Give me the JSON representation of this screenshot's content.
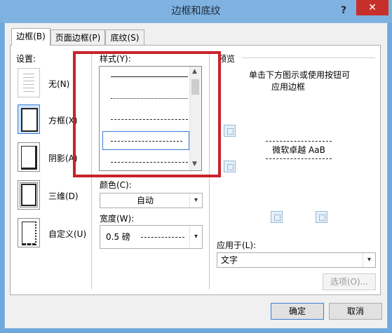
{
  "window": {
    "title": "边框和底纹",
    "help": "?",
    "close": "✕"
  },
  "tabs": [
    {
      "label": "边框(B)"
    },
    {
      "label": "页面边框(P)"
    },
    {
      "label": "底纹(S)"
    }
  ],
  "settings": {
    "label": "设置:",
    "presets": [
      {
        "label": "无(N)"
      },
      {
        "label": "方框(X)"
      },
      {
        "label": "阴影(A)"
      },
      {
        "label": "三维(D)"
      },
      {
        "label": "自定义(U)"
      }
    ]
  },
  "style": {
    "label": "样式(Y):"
  },
  "color": {
    "label": "颜色(C):",
    "value": "自动"
  },
  "width": {
    "label": "宽度(W):",
    "value": "0.5 磅"
  },
  "preview": {
    "label": "预览",
    "hint_line1": "单击下方图示或使用按钮可",
    "hint_line2": "应用边框",
    "sample_text": "微软卓越 AaB"
  },
  "apply_to": {
    "label": "应用于(L):",
    "value": "文字"
  },
  "buttons": {
    "options": "选项(O)...",
    "ok": "确定",
    "cancel": "取消"
  },
  "colors": {
    "annotation": "#c8232a",
    "accent": "#3b7dd8"
  }
}
